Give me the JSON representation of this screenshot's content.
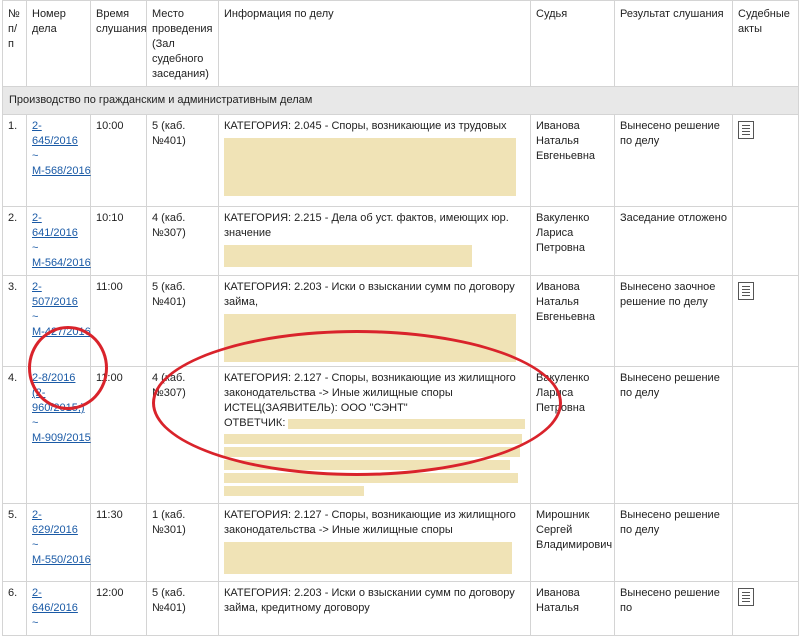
{
  "headers": {
    "num": "№ п/п",
    "case": "Номер дела",
    "time": "Время слушания",
    "place": "Место проведения (Зал судебного заседания)",
    "info": "Информация по делу",
    "judge": "Судья",
    "result": "Результат слушания",
    "acts": "Судебные акты"
  },
  "section_title": "Производство по гражданским и административным делам",
  "tilde": "~",
  "rows": [
    {
      "num": "1.",
      "case1": "2-645/2016",
      "case2": "М-568/2016",
      "time": "10:00",
      "place": "5 (каб. №401)",
      "info": "КАТЕГОРИЯ: 2.045 - Споры, возникающие из трудовых",
      "judge": "Иванова Наталья Евгеньевна",
      "result": "Вынесено решение по делу",
      "acts_icon": "document-icon"
    },
    {
      "num": "2.",
      "case1": "2-641/2016",
      "case2": "М-564/2016",
      "time": "10:10",
      "place": "4 (каб. №307)",
      "info": "КАТЕГОРИЯ: 2.215 - Дела об уст. фактов, имеющих юр. значение",
      "judge": "Вакуленко Лариса Петровна",
      "result": "Заседание отложено",
      "acts_icon": ""
    },
    {
      "num": "3.",
      "case1": "2-507/2016",
      "case2": "М-427/2016",
      "time": "11:00",
      "place": "5 (каб. №401)",
      "info": "КАТЕГОРИЯ: 2.203 - Иски о взыскании сумм по договору займа,",
      "judge": "Иванова Наталья Евгеньевна",
      "result": "Вынесено заочное решение по делу",
      "acts_icon": "document-icon"
    },
    {
      "num": "4.",
      "case1": "2-8/2016 (2-960/2015;)",
      "case2": "М-909/2015",
      "time": "11:00",
      "place": "4 (каб. №307)",
      "info": "КАТЕГОРИЯ: 2.127 - Споры, возникающие из жилищного законодательства -> Иные жилищные споры",
      "info_extra": "ИСТЕЦ(ЗАЯВИТЕЛЬ): ООО \"СЭНТ\"",
      "info_extra2": "ОТВЕТЧИК:",
      "judge": "Вакуленко Лариса Петровна",
      "result": "Вынесено решение по делу",
      "acts_icon": ""
    },
    {
      "num": "5.",
      "case1": "2-629/2016",
      "case2": "М-550/2016",
      "time": "11:30",
      "place": "1 (каб. №301)",
      "info": "КАТЕГОРИЯ: 2.127 - Споры, возникающие из жилищного законодательства -> Иные жилищные споры",
      "judge": "Мирошник Сергей Владимирович",
      "result": "Вынесено решение по делу",
      "acts_icon": ""
    },
    {
      "num": "6.",
      "case1": "2-646/2016",
      "case2": "",
      "time": "12:00",
      "place": "5 (каб. №401)",
      "info": "КАТЕГОРИЯ: 2.203 - Иски о взыскании сумм по договору займа, кредитному договору",
      "judge": "Иванова Наталья",
      "result": "Вынесено решение по",
      "acts_icon": "document-icon"
    }
  ]
}
